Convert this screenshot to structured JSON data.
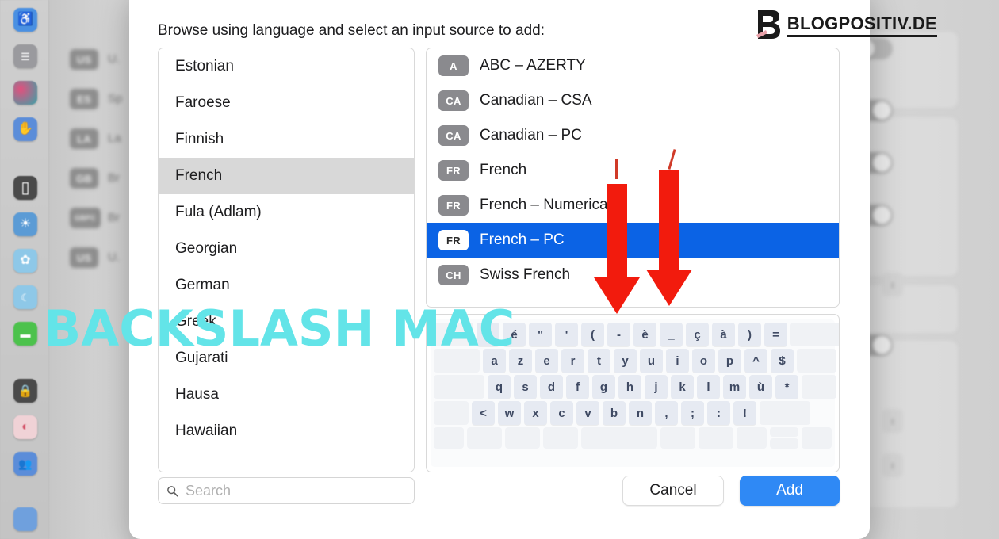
{
  "dialog": {
    "title": "Browse using language and select an input source to add:",
    "search_placeholder": "Search",
    "cancel_label": "Cancel",
    "add_label": "Add"
  },
  "languages": [
    {
      "label": "Estonian",
      "selected": false
    },
    {
      "label": "Faroese",
      "selected": false
    },
    {
      "label": "Finnish",
      "selected": false
    },
    {
      "label": "French",
      "selected": true
    },
    {
      "label": "Fula (Adlam)",
      "selected": false
    },
    {
      "label": "Georgian",
      "selected": false
    },
    {
      "label": "German",
      "selected": false
    },
    {
      "label": "Greek",
      "selected": false
    },
    {
      "label": "Gujarati",
      "selected": false
    },
    {
      "label": "Hausa",
      "selected": false
    },
    {
      "label": "Hawaiian",
      "selected": false
    }
  ],
  "input_sources": [
    {
      "badge": "A",
      "label": "ABC – AZERTY",
      "selected": false
    },
    {
      "badge": "CA",
      "label": "Canadian – CSA",
      "selected": false
    },
    {
      "badge": "CA",
      "label": "Canadian – PC",
      "selected": false
    },
    {
      "badge": "FR",
      "label": "French",
      "selected": false
    },
    {
      "badge": "FR",
      "label": "French – Numerical",
      "selected": false
    },
    {
      "badge": "FR",
      "label": "French – PC",
      "selected": true
    },
    {
      "badge": "CH",
      "label": "Swiss French",
      "selected": false
    }
  ],
  "keyboard_preview": {
    "layout_name": "French – PC",
    "rows": [
      [
        "",
        "&",
        "é",
        "\"",
        "'",
        "(",
        "-",
        "è",
        "_",
        "ç",
        "à",
        ")",
        "=",
        ""
      ],
      [
        "",
        "a",
        "z",
        "e",
        "r",
        "t",
        "y",
        "u",
        "i",
        "o",
        "p",
        "^",
        "$",
        ""
      ],
      [
        "",
        "q",
        "s",
        "d",
        "f",
        "g",
        "h",
        "j",
        "k",
        "l",
        "m",
        "ù",
        "*",
        ""
      ],
      [
        "",
        "<",
        "w",
        "x",
        "c",
        "v",
        "b",
        "n",
        ",",
        ";",
        ":",
        "!",
        ""
      ],
      [
        "",
        "",
        "",
        "",
        "",
        "",
        "",
        "",
        "",
        ""
      ]
    ]
  },
  "branding": {
    "logo_text": "BLOGPOSITIV.DE",
    "watermark_text": "BACKSLASH MAC",
    "watermark_color": "#63e4e8",
    "accent_selection": "#0b63e5",
    "accent_button": "#2f89f5",
    "arrow_color": "#f21b0d"
  },
  "background": {
    "input_source_rows": [
      {
        "badge": "US",
        "label": "U."
      },
      {
        "badge": "ES",
        "label": "Sp"
      },
      {
        "badge": "LA",
        "label": "La"
      },
      {
        "badge": "GB",
        "label": "Br"
      },
      {
        "badge": "GBPC",
        "label": "Br"
      },
      {
        "badge": "US",
        "label": "U."
      }
    ],
    "right_controls": [
      {
        "type": "toggle",
        "state": "off"
      },
      {
        "type": "toggle",
        "state": "on"
      },
      {
        "type": "toggle",
        "state": "on"
      },
      {
        "type": "toggle",
        "state": "on"
      },
      {
        "type": "stepper",
        "value": "e"
      },
      {
        "type": "toggle",
        "state": "on"
      },
      {
        "type": "stepper",
        "value": "”"
      },
      {
        "type": "stepper",
        "value": "’"
      }
    ],
    "sidebar_icons": [
      {
        "name": "accessibility-icon",
        "glyph": "Ⓘ",
        "color": "#4a90e2"
      },
      {
        "name": "control-center-icon",
        "glyph": "☰",
        "color": "#8e8e93"
      },
      {
        "name": "siri-icon",
        "glyph": "●",
        "color": "#b0476b"
      },
      {
        "name": "privacy-hand-icon",
        "glyph": "✋",
        "color": "#5b8dd9"
      },
      {
        "name": "desktop-dock-icon",
        "glyph": "▭",
        "color": "#4a4a4a"
      },
      {
        "name": "displays-icon",
        "glyph": "☀",
        "color": "#5b9bd5"
      },
      {
        "name": "wallpaper-icon",
        "glyph": "✿",
        "color": "#8ec8e8"
      },
      {
        "name": "screensaver-icon",
        "glyph": "☾",
        "color": "#8ec8e8"
      },
      {
        "name": "battery-icon",
        "glyph": "▬",
        "color": "#4cc24c"
      },
      {
        "name": "lock-screen-icon",
        "glyph": "⚿",
        "color": "#4a4a4a"
      },
      {
        "name": "touch-id-icon",
        "glyph": "⌘",
        "color": "#e8a0a8"
      },
      {
        "name": "users-groups-icon",
        "glyph": "὆5",
        "color": "#5b8dd9"
      }
    ]
  }
}
